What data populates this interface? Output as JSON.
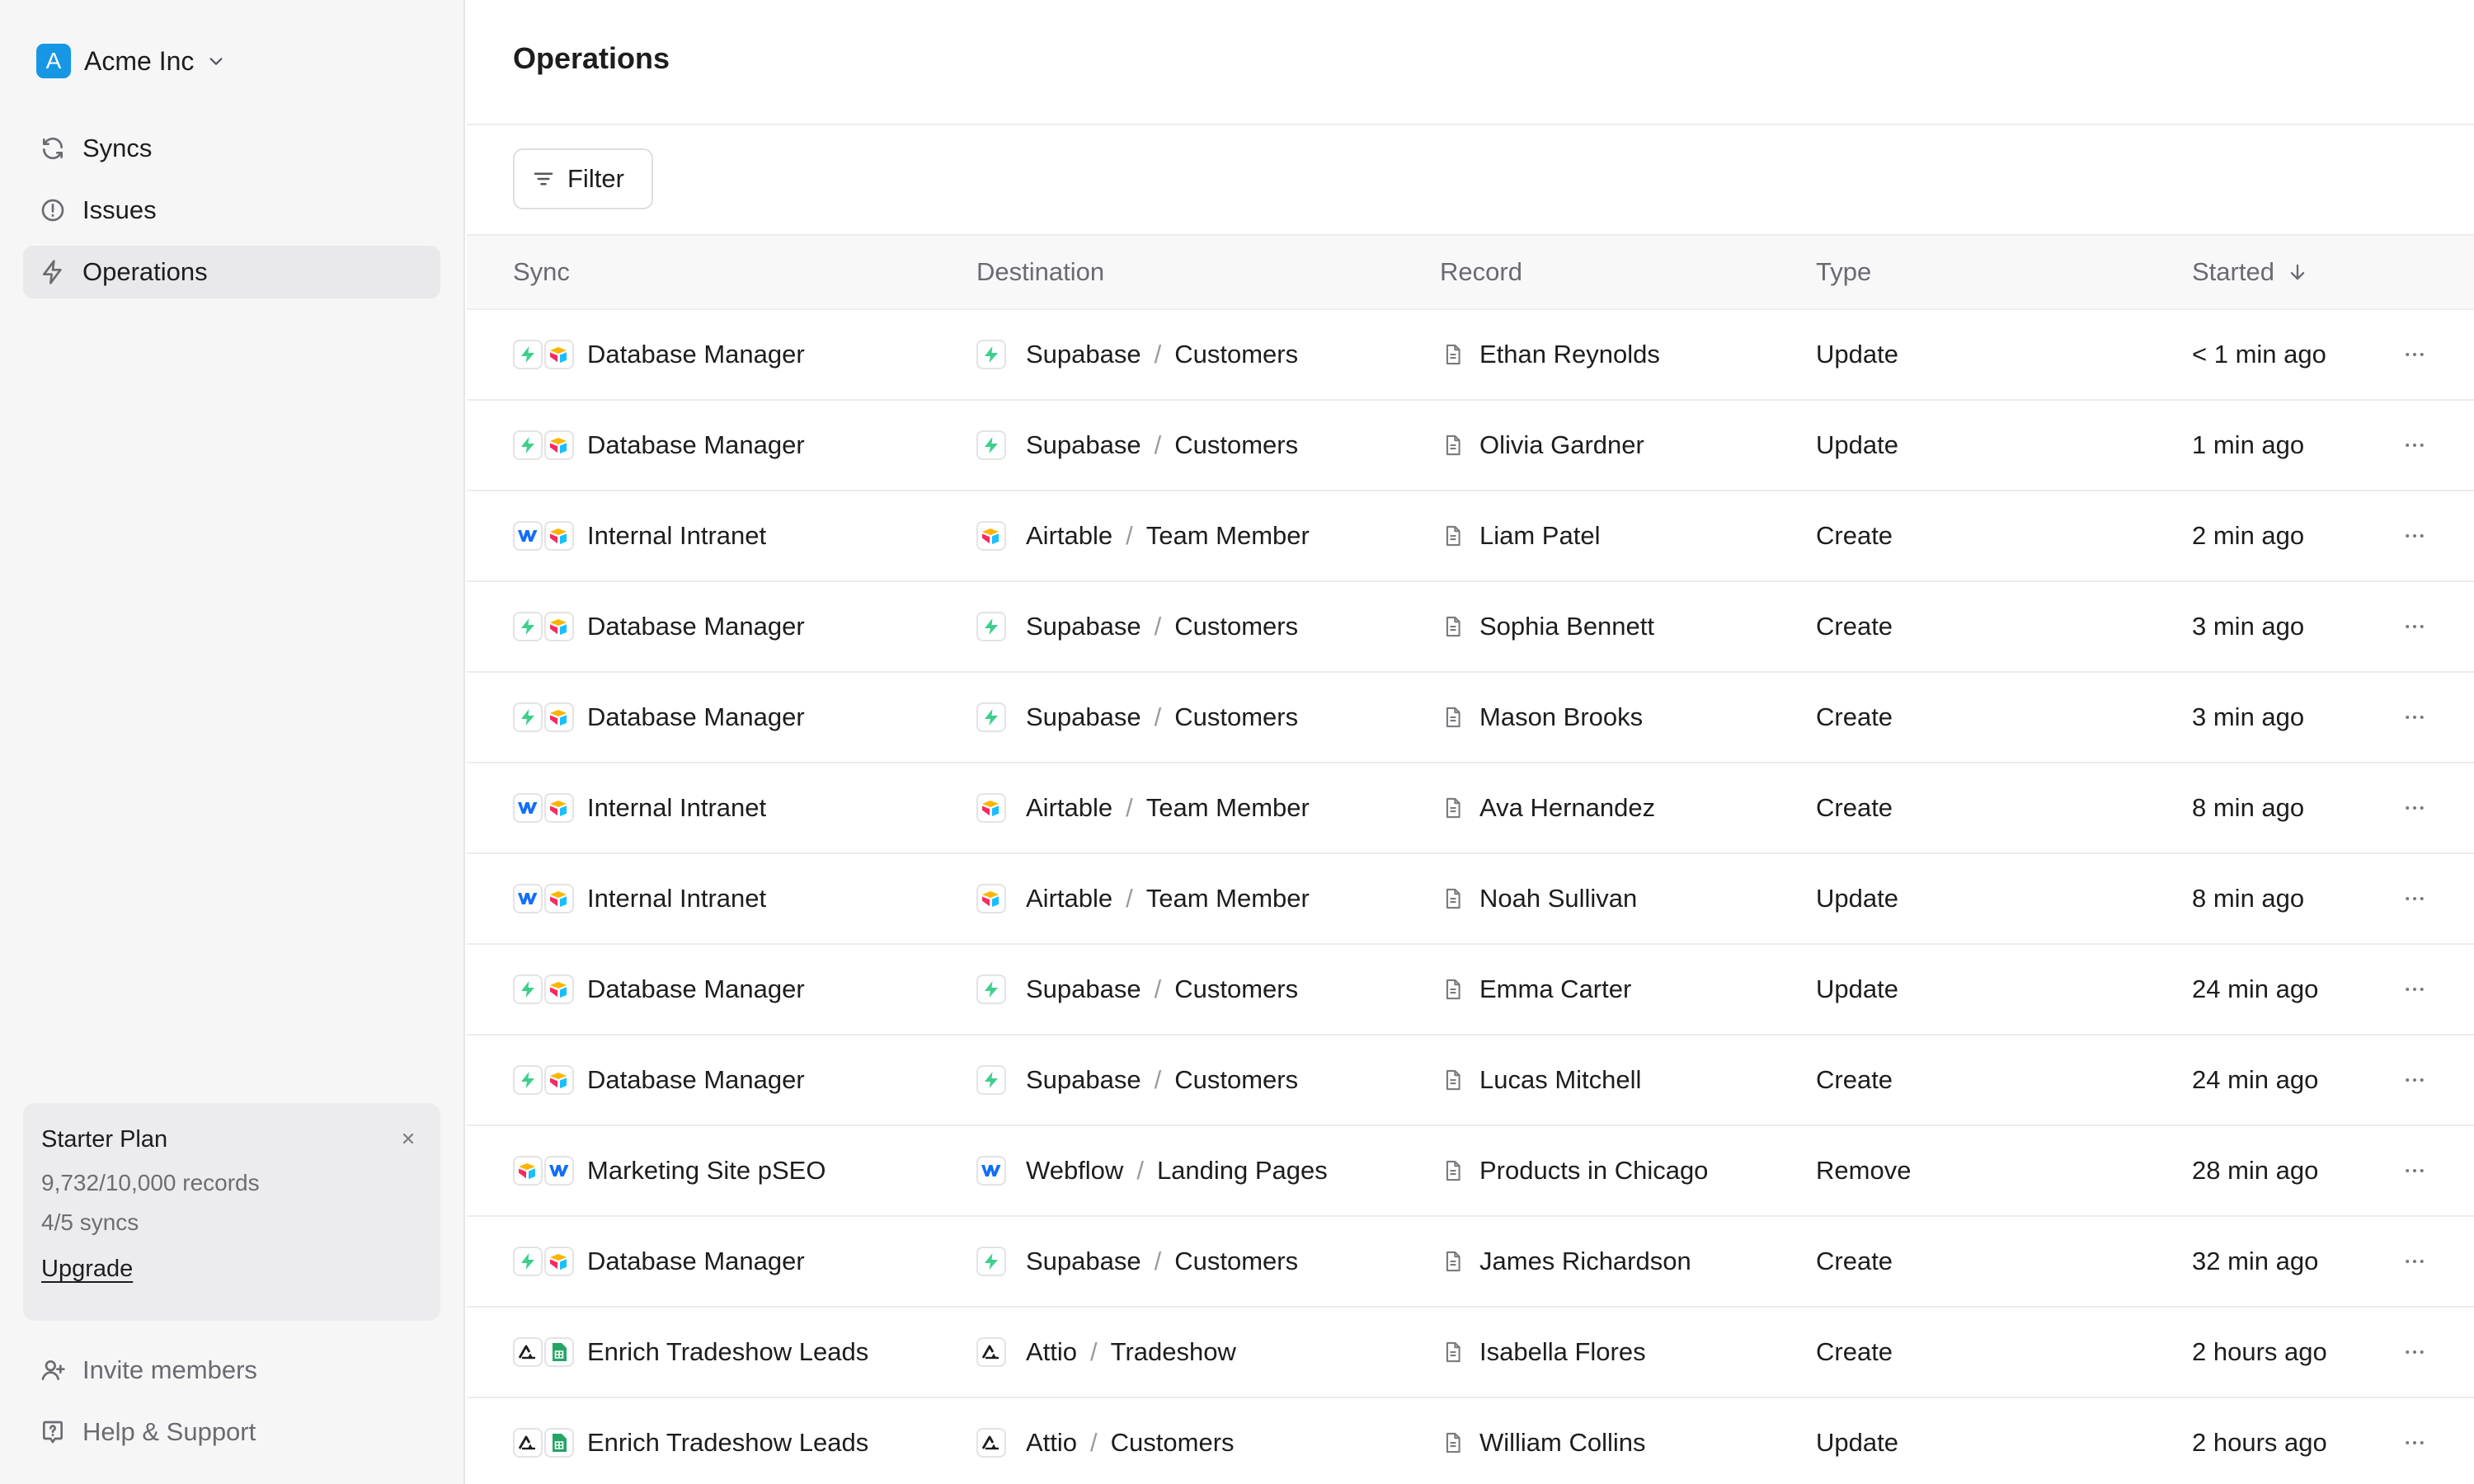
{
  "sidebar": {
    "org": {
      "initial": "A",
      "name": "Acme Inc"
    },
    "nav": [
      {
        "label": "Syncs",
        "icon": "refresh-icon"
      },
      {
        "label": "Issues",
        "icon": "alert-circle-icon"
      },
      {
        "label": "Operations",
        "icon": "bolt-icon",
        "active": true
      }
    ],
    "plan": {
      "title": "Starter Plan",
      "records": "9,732/10,000 records",
      "syncs": "4/5 syncs",
      "upgrade": "Upgrade"
    },
    "footer": [
      {
        "label": "Invite members",
        "icon": "user-plus-icon"
      },
      {
        "label": "Help & Support",
        "icon": "help-icon"
      }
    ]
  },
  "main": {
    "title": "Operations",
    "filter_label": "Filter",
    "columns": {
      "sync": "Sync",
      "destination": "Destination",
      "record": "Record",
      "type": "Type",
      "started": "Started"
    },
    "rows": [
      {
        "sync": "Database Manager",
        "pair": [
          "supabase",
          "airtable"
        ],
        "dest_app": "Supabase",
        "dest_icon": "supabase",
        "dest_table": "Customers",
        "record": "Ethan Reynolds",
        "type": "Update",
        "started": "< 1 min ago"
      },
      {
        "sync": "Database Manager",
        "pair": [
          "supabase",
          "airtable"
        ],
        "dest_app": "Supabase",
        "dest_icon": "supabase",
        "dest_table": "Customers",
        "record": "Olivia Gardner",
        "type": "Update",
        "started": "1 min ago"
      },
      {
        "sync": "Internal Intranet",
        "pair": [
          "webflow",
          "airtable"
        ],
        "dest_app": "Airtable",
        "dest_icon": "airtable",
        "dest_table": "Team Member",
        "record": "Liam Patel",
        "type": "Create",
        "started": "2 min ago"
      },
      {
        "sync": "Database Manager",
        "pair": [
          "supabase",
          "airtable"
        ],
        "dest_app": "Supabase",
        "dest_icon": "supabase",
        "dest_table": "Customers",
        "record": "Sophia Bennett",
        "type": "Create",
        "started": "3 min ago"
      },
      {
        "sync": "Database Manager",
        "pair": [
          "supabase",
          "airtable"
        ],
        "dest_app": "Supabase",
        "dest_icon": "supabase",
        "dest_table": "Customers",
        "record": "Mason Brooks",
        "type": "Create",
        "started": "3 min ago"
      },
      {
        "sync": "Internal Intranet",
        "pair": [
          "webflow",
          "airtable"
        ],
        "dest_app": "Airtable",
        "dest_icon": "airtable",
        "dest_table": "Team Member",
        "record": "Ava Hernandez",
        "type": "Create",
        "started": "8 min ago"
      },
      {
        "sync": "Internal Intranet",
        "pair": [
          "webflow",
          "airtable"
        ],
        "dest_app": "Airtable",
        "dest_icon": "airtable",
        "dest_table": "Team Member",
        "record": "Noah Sullivan",
        "type": "Update",
        "started": "8 min ago"
      },
      {
        "sync": "Database Manager",
        "pair": [
          "supabase",
          "airtable"
        ],
        "dest_app": "Supabase",
        "dest_icon": "supabase",
        "dest_table": "Customers",
        "record": "Emma Carter",
        "type": "Update",
        "started": "24 min ago"
      },
      {
        "sync": "Database Manager",
        "pair": [
          "supabase",
          "airtable"
        ],
        "dest_app": "Supabase",
        "dest_icon": "supabase",
        "dest_table": "Customers",
        "record": "Lucas Mitchell",
        "type": "Create",
        "started": "24 min ago"
      },
      {
        "sync": "Marketing Site pSEO",
        "pair": [
          "airtable",
          "webflow"
        ],
        "dest_app": "Webflow",
        "dest_icon": "webflow",
        "dest_table": "Landing Pages",
        "record": "Products in Chicago",
        "type": "Remove",
        "started": "28 min ago"
      },
      {
        "sync": "Database Manager",
        "pair": [
          "supabase",
          "airtable"
        ],
        "dest_app": "Supabase",
        "dest_icon": "supabase",
        "dest_table": "Customers",
        "record": "James Richardson",
        "type": "Create",
        "started": "32 min ago"
      },
      {
        "sync": "Enrich Tradeshow Leads",
        "pair": [
          "attio",
          "sheets"
        ],
        "dest_app": "Attio",
        "dest_icon": "attio",
        "dest_table": "Tradeshow",
        "record": "Isabella Flores",
        "type": "Create",
        "started": "2 hours ago"
      },
      {
        "sync": "Enrich Tradeshow Leads",
        "pair": [
          "attio",
          "sheets"
        ],
        "dest_app": "Attio",
        "dest_icon": "attio",
        "dest_table": "Customers",
        "record": "William Collins",
        "type": "Update",
        "started": "2 hours ago"
      }
    ]
  },
  "colors": {
    "accent": "#1597e6",
    "supabase": "#3ecf8e",
    "webflow": "#146ef5",
    "sheets": "#23a566"
  }
}
